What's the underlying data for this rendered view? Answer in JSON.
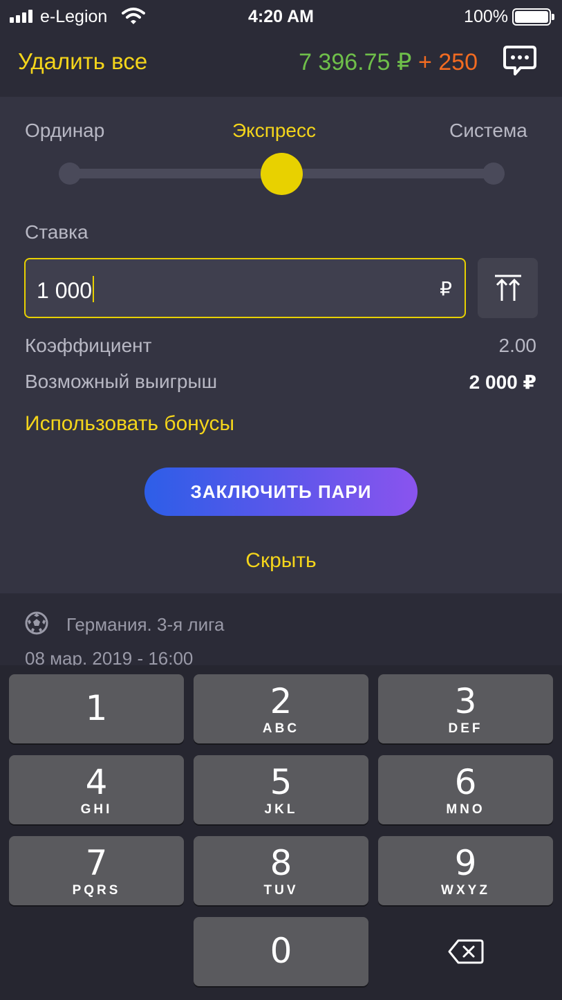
{
  "status_bar": {
    "carrier": "e-Legion",
    "time": "4:20 AM",
    "battery": "100%"
  },
  "header": {
    "delete_all": "Удалить все",
    "balance": "7 396.75 ₽",
    "bonus": "+ 250",
    "chat_icon": "chat-bubble-icon"
  },
  "bet_types": {
    "items": [
      "Ординар",
      "Экспресс",
      "Система"
    ],
    "selected": "Экспресс"
  },
  "stake": {
    "label": "Ставка",
    "value": "1 000",
    "currency": "₽",
    "max_icon": "max-stake-icon"
  },
  "summary": {
    "coefficient_label": "Коэффициент",
    "coefficient_value": "2.00",
    "win_label": "Возможный выигрыш",
    "win_value": "2 000 ₽"
  },
  "use_bonuses": "Использовать бонусы",
  "place_bet": "ЗАКЛЮЧИТЬ ПАРИ",
  "hide": "Скрыть",
  "event": {
    "sport_icon": "soccer-ball-icon",
    "league": "Германия. 3-я лига",
    "date": "08 мар. 2019 - 16:00"
  },
  "keyboard": {
    "keys": [
      {
        "digit": "1",
        "letters": ""
      },
      {
        "digit": "2",
        "letters": "ABC"
      },
      {
        "digit": "3",
        "letters": "DEF"
      },
      {
        "digit": "4",
        "letters": "GHI"
      },
      {
        "digit": "5",
        "letters": "JKL"
      },
      {
        "digit": "6",
        "letters": "MNO"
      },
      {
        "digit": "7",
        "letters": "PQRS"
      },
      {
        "digit": "8",
        "letters": "TUV"
      },
      {
        "digit": "9",
        "letters": "WXYZ"
      },
      {
        "digit": "0",
        "letters": ""
      }
    ],
    "backspace_icon": "backspace-icon"
  }
}
